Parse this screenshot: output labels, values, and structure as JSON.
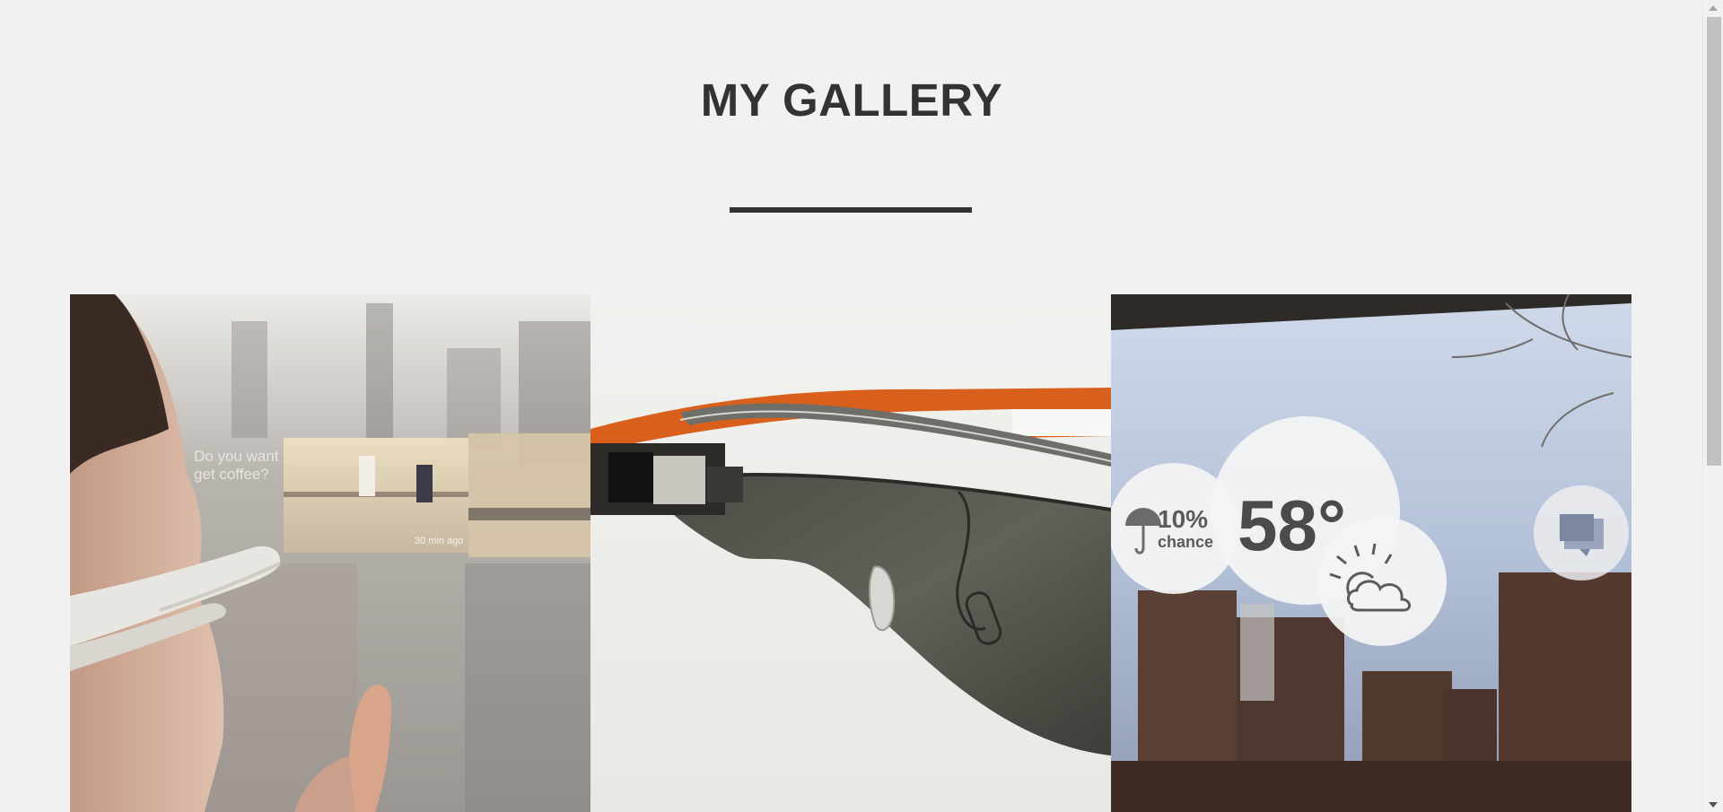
{
  "gallery": {
    "title": "MY GALLERY",
    "tiles": [
      {
        "name": "smart-glasses-user",
        "overlay_text_line1": "Do you want to",
        "overlay_text_line2": "get coffee?",
        "overlay_time": "30 min ago"
      },
      {
        "name": "smart-glasses-product"
      },
      {
        "name": "weather-overlay",
        "rain_percent": "10%",
        "rain_label": "chance",
        "temperature": "58°"
      }
    ]
  },
  "colors": {
    "background": "#f1f1f1",
    "title": "#333333",
    "accent_orange": "#d9601c"
  },
  "icons": [
    "umbrella-icon",
    "partly-cloudy-icon",
    "chat-bubble-icon",
    "scroll-up-icon",
    "scroll-down-icon"
  ]
}
